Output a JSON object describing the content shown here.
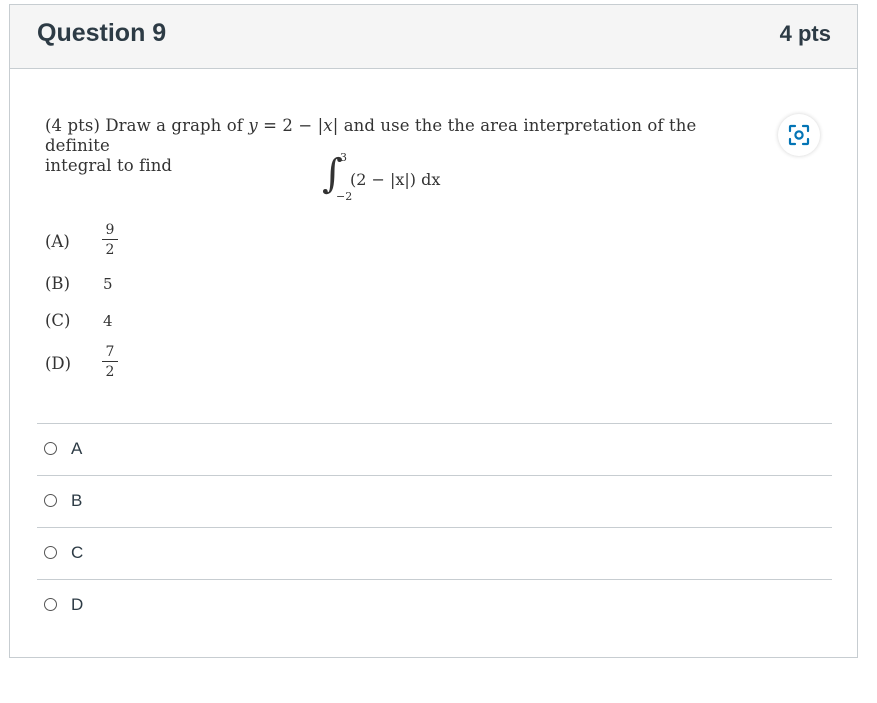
{
  "question": {
    "title": "Question 9",
    "points": "4 pts"
  },
  "stem": {
    "prefix": "(4 pts) Draw a graph of",
    "formula_y": "y",
    "formula_eq": "= 2 − |",
    "formula_x": "x",
    "formula_end": "|",
    "suffix": "and use the the area interpretation of the definite",
    "line2": "integral to find"
  },
  "integral": {
    "sign": "∫",
    "upper": "3",
    "lower": "−2",
    "body": "(2 − |x|) dx"
  },
  "choices": [
    {
      "label": "(A)",
      "num": "9",
      "den": "2"
    },
    {
      "label": "(B)",
      "value": "5"
    },
    {
      "label": "(C)",
      "value": "4"
    },
    {
      "label": "(D)",
      "num": "7",
      "den": "2"
    }
  ],
  "answers": [
    {
      "label": "A"
    },
    {
      "label": "B"
    },
    {
      "label": "C"
    },
    {
      "label": "D"
    }
  ],
  "icons": {
    "scan": "scan-icon",
    "accent": "#0374b5"
  }
}
